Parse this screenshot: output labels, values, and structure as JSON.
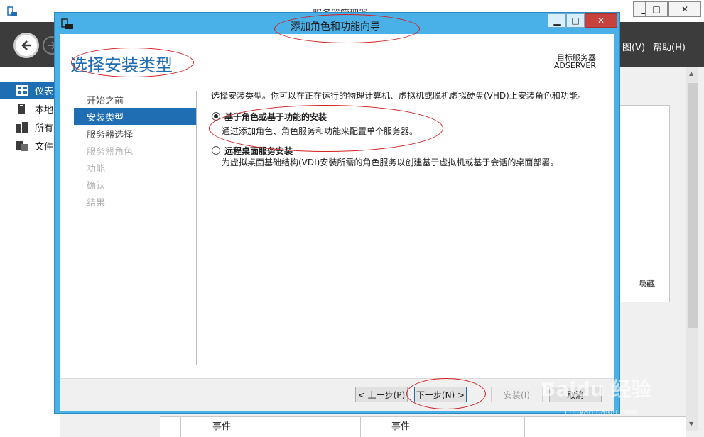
{
  "background_window": {
    "title": "服务器管理器",
    "menu": {
      "view": "图(V)",
      "help": "帮助(H)"
    },
    "sidebar": [
      {
        "label": "仪表",
        "icon": "dashboard-icon"
      },
      {
        "label": "本地",
        "icon": "local-server-icon"
      },
      {
        "label": "所有",
        "icon": "all-servers-icon"
      },
      {
        "label": "文件",
        "icon": "file-services-icon"
      }
    ],
    "hide_link": "隐藏",
    "bottom_events": [
      "事件",
      "事件"
    ]
  },
  "dialog": {
    "title": "添加角色和功能向导",
    "heading": "选择安装类型",
    "target_server_label": "目标服务器",
    "target_server_name": "ADSERVER",
    "nav": [
      {
        "label": "开始之前",
        "state": "normal"
      },
      {
        "label": "安装类型",
        "state": "active"
      },
      {
        "label": "服务器选择",
        "state": "normal"
      },
      {
        "label": "服务器角色",
        "state": "disabled"
      },
      {
        "label": "功能",
        "state": "disabled"
      },
      {
        "label": "确认",
        "state": "disabled"
      },
      {
        "label": "结果",
        "state": "disabled"
      }
    ],
    "intro": "选择安装类型。你可以在正在运行的物理计算机、虚拟机或脱机虚拟硬盘(VHD)上安装角色和功能。",
    "options": [
      {
        "title": "基于角色或基于功能的安装",
        "desc": "通过添加角色、角色服务和功能来配置单个服务器。",
        "checked": true
      },
      {
        "title": "远程桌面服务安装",
        "desc": "为虚拟桌面基础结构(VDI)安装所需的角色服务以创建基于虚拟机或基于会话的桌面部署。",
        "checked": false
      }
    ],
    "buttons": {
      "prev": "< 上一步(P)",
      "next": "下一步(N) >",
      "install": "安装(I)",
      "cancel": "取消"
    }
  },
  "watermark": {
    "text": "Baidu 经验",
    "sub": "jingyan.baidu.com"
  },
  "colors": {
    "accent": "#1f6db3",
    "dialog_frame": "#4ab0e8",
    "annotation": "#d22020"
  }
}
